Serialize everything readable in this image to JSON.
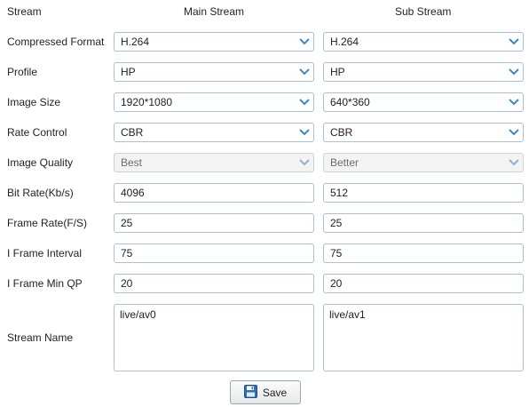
{
  "columns": {
    "label": "Stream",
    "main": "Main Stream",
    "sub": "Sub Stream"
  },
  "rows": {
    "compressed_format": {
      "label": "Compressed Format",
      "main": "H.264",
      "sub": "H.264"
    },
    "profile": {
      "label": "Profile",
      "main": "HP",
      "sub": "HP"
    },
    "image_size": {
      "label": "Image Size",
      "main": "1920*1080",
      "sub": "640*360"
    },
    "rate_control": {
      "label": "Rate Control",
      "main": "CBR",
      "sub": "CBR"
    },
    "image_quality": {
      "label": "Image Quality",
      "main": "Best",
      "sub": "Better"
    },
    "bit_rate": {
      "label": "Bit Rate(Kb/s)",
      "main": "4096",
      "sub": "512"
    },
    "frame_rate": {
      "label": "Frame Rate(F/S)",
      "main": "25",
      "sub": "25"
    },
    "i_frame_interval": {
      "label": "I Frame Interval",
      "main": "75",
      "sub": "75"
    },
    "i_frame_min_qp": {
      "label": "I Frame Min QP",
      "main": "20",
      "sub": "20"
    },
    "stream_name": {
      "label": "Stream Name",
      "main": "live/av0",
      "sub": "live/av1"
    }
  },
  "save_button": {
    "label": "Save",
    "icon": "floppy-disk-icon"
  },
  "colors": {
    "accent": "#3f86c8",
    "border": "#a9c0d8"
  }
}
